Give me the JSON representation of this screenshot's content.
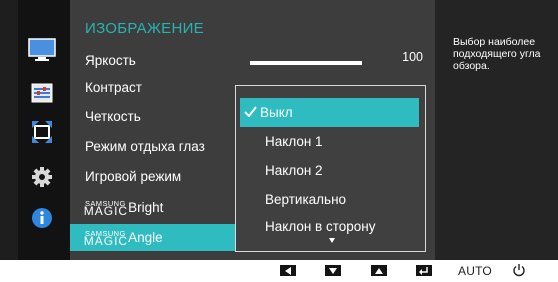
{
  "menu": {
    "title": "ИЗОБРАЖЕНИЕ",
    "items": [
      {
        "label": "Яркость"
      },
      {
        "label": "Контраст"
      },
      {
        "label": "Четкость"
      },
      {
        "label": "Режим отдыха глаз"
      },
      {
        "label": "Игровой режим"
      },
      {
        "label_small": "SAMSUNG",
        "label_big": "MAGIC",
        "label_rest": "Bright"
      },
      {
        "label_small": "SAMSUNG",
        "label_big": "MAGIC",
        "label_rest": "Angle"
      }
    ],
    "brightness_value": "100"
  },
  "dropdown": {
    "options": [
      "Выкл",
      "Наклон 1",
      "Наклон 2",
      "Вертикально",
      "Наклон в сторону"
    ],
    "selected_index": 0
  },
  "help": {
    "text": "Выбор наиболее подходящего угла обзора."
  },
  "sidebar": {
    "icons": [
      "monitor-icon",
      "settings-sliders-icon",
      "resize-arrows-icon",
      "gear-icon",
      "info-icon"
    ]
  },
  "bottom_bar": {
    "keys": [
      "left-key-icon",
      "down-key-icon",
      "up-key-icon",
      "enter-key-icon"
    ],
    "auto_label": "AUTO",
    "power_icon": "power-icon"
  },
  "colors": {
    "accent": "#2ebcc0",
    "title": "#28b3b3",
    "panel": "#3d3d3d",
    "background": "#1e1e1e"
  }
}
